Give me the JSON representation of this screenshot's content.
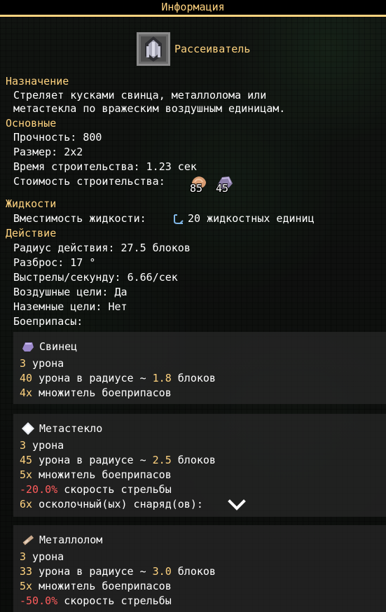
{
  "window": {
    "title": "Информация"
  },
  "block": {
    "name": "Рассеиватель"
  },
  "purpose": {
    "header": "Назначение",
    "line1": "Стреляет кусками свинца, металлолома или",
    "line2": "метастекла по вражеским воздушным единицам."
  },
  "general": {
    "header": "Основные",
    "health_label": "Прочность: ",
    "health_value": "800",
    "size_label": "Размер: ",
    "size_value": "2x2",
    "build_time_label": "Время строительства: ",
    "build_time_value": "1.23 сек",
    "build_cost_label": "Стоимость строительства:",
    "cost_copper": "85",
    "cost_lead": "45"
  },
  "liquids": {
    "header": "Жидкости",
    "capacity_label": "Вместимость жидкости: ",
    "capacity_value": "20 жидкостных единиц"
  },
  "action": {
    "header": "Действие",
    "range_label": "Радиус действия: ",
    "range_value": "27.5 блоков",
    "inaccuracy_label": "Разброс: ",
    "inaccuracy_value": "17 °",
    "reload_label": "Выстрелы/секунду: ",
    "reload_value": "6.66/сек",
    "air_label": "Воздушные цели: ",
    "air_value": "Да",
    "ground_label": "Наземные цели: ",
    "ground_value": "Нет",
    "ammo_label": "Боеприпасы:"
  },
  "ammo": [
    {
      "name": "Свинец",
      "damage_value": "3",
      "damage_text": " урона",
      "splash_value": "40",
      "splash_text": " урона в радиусе ~ ",
      "splash_radius": "1.8",
      "splash_unit": " блоков",
      "multiplier_value": "4x",
      "multiplier_text": " множитель боеприпасов"
    },
    {
      "name": "Метастекло",
      "damage_value": "3",
      "damage_text": " урона",
      "splash_value": "45",
      "splash_text": " урона в радиусе ~ ",
      "splash_radius": "2.5",
      "splash_unit": " блоков",
      "multiplier_value": "5x",
      "multiplier_text": " множитель боеприпасов",
      "rate_value": "-20.0%",
      "rate_text": " скорость стрельбы",
      "frag_value": "6x",
      "frag_text": " осколочный(ых) снаряд(ов):"
    },
    {
      "name": "Металлолом",
      "damage_value": "3",
      "damage_text": " урона",
      "splash_value": "33",
      "splash_text": " урона в радиусе ~ ",
      "splash_radius": "3.0",
      "splash_unit": " блоков",
      "multiplier_value": "5x",
      "multiplier_text": " множитель боеприпасов",
      "rate_value": "-50.0%",
      "rate_text": " скорость стрельбы"
    }
  ],
  "icons": {
    "block": "scatter-turret-icon",
    "copper": "copper-icon",
    "lead": "lead-icon",
    "liquid": "liquid-icon",
    "expand": "chevron-down-icon"
  },
  "colors": {
    "accent": "#ffd37f",
    "negative": "#ff5c5c",
    "text": "#ffffff"
  }
}
